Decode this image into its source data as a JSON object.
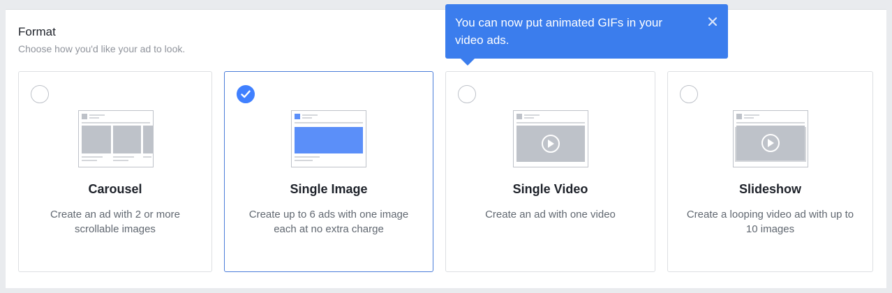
{
  "format": {
    "heading": "Format",
    "subheading": "Choose how you'd like your ad to look."
  },
  "options": [
    {
      "title": "Carousel",
      "description": "Create an ad with 2 or more scrollable images",
      "selected": false,
      "icon": "carousel-preview-icon"
    },
    {
      "title": "Single Image",
      "description": "Create up to 6 ads with one image each at no extra charge",
      "selected": true,
      "icon": "single-image-preview-icon"
    },
    {
      "title": "Single Video",
      "description": "Create an ad with one video",
      "selected": false,
      "icon": "single-video-preview-icon"
    },
    {
      "title": "Slideshow",
      "description": "Create a looping video ad with up to 10 images",
      "selected": false,
      "icon": "slideshow-preview-icon"
    }
  ],
  "tooltip": {
    "text": "You can now put animated GIFs in your video ads.",
    "close_icon": "close-icon"
  },
  "colors": {
    "accent": "#4080ff",
    "tooltip_bg": "#3b7ded",
    "selected_border": "#4a7cd9",
    "placeholder_gray": "#bec2c9",
    "highlight_blue": "#5b8ff9"
  }
}
